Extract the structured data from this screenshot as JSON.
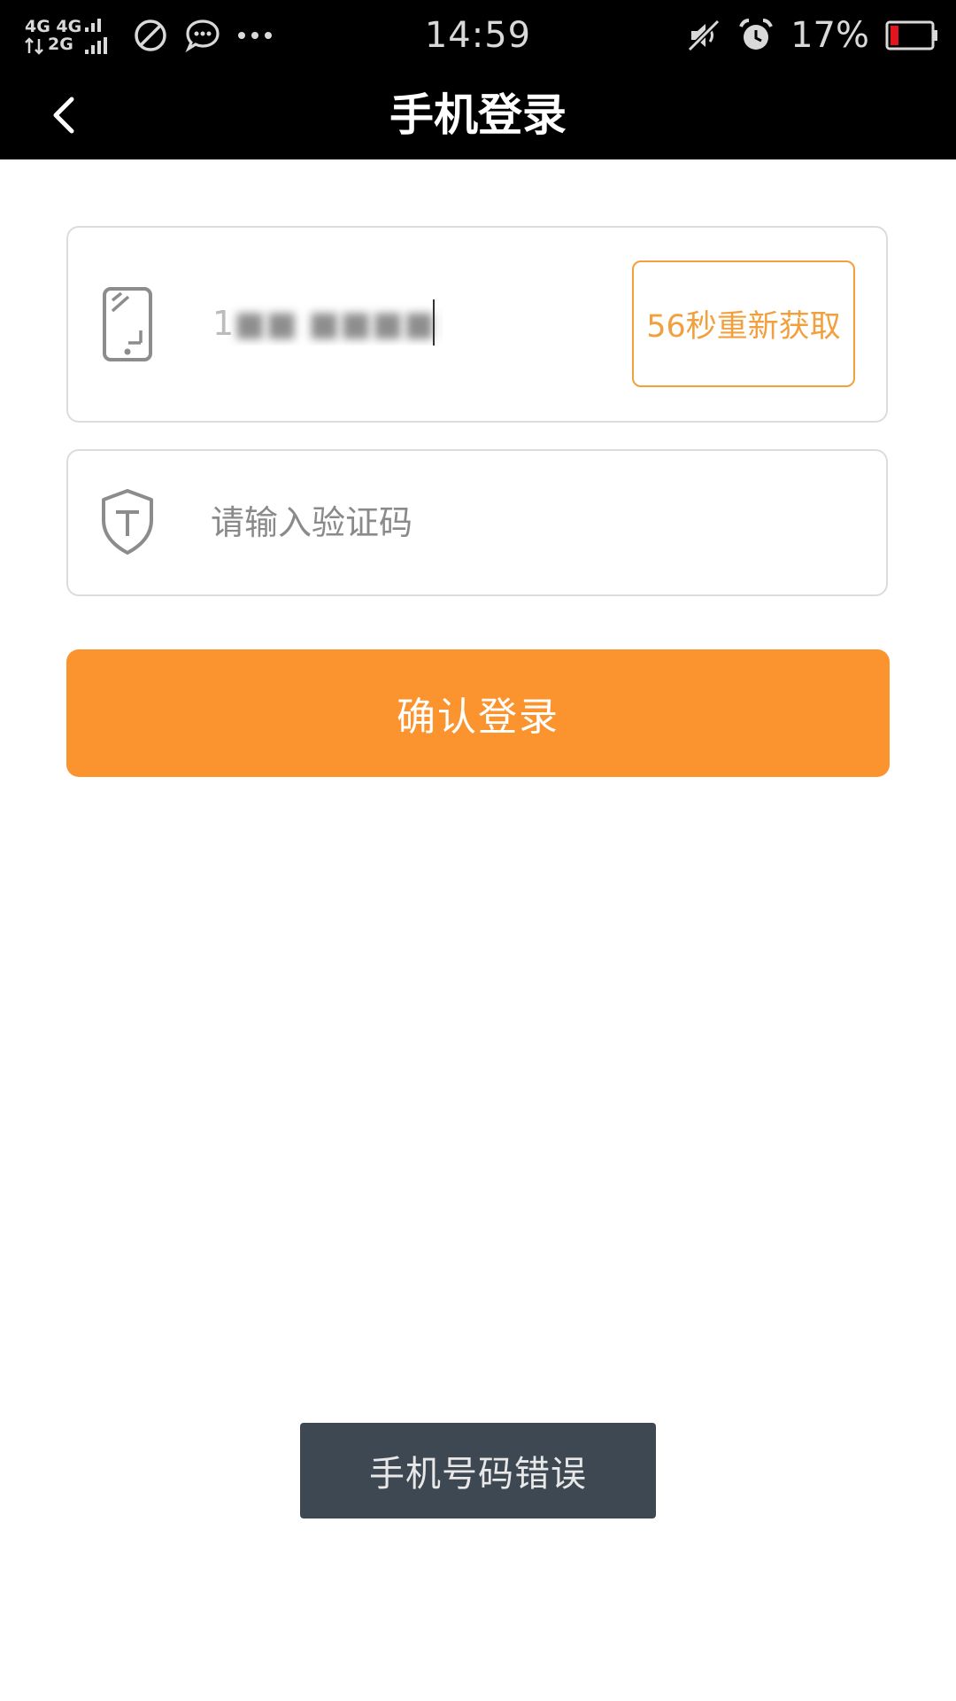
{
  "status_bar": {
    "network_line1": "4G 4G",
    "network_line2": "2G",
    "time": "14:59",
    "battery_percent": "17%",
    "icons": [
      "signal-icon",
      "do-not-disturb-icon",
      "message-icon",
      "more-icon",
      "mute-icon",
      "alarm-icon",
      "battery-icon"
    ]
  },
  "header": {
    "title": "手机登录",
    "back_icon": "chevron-left-icon"
  },
  "login_form": {
    "phone_icon": "phone-icon",
    "phone_value": "1",
    "resend_label": "56秒重新获取",
    "code_icon": "shield-icon",
    "code_placeholder": "请输入验证码",
    "confirm_label": "确认登录"
  },
  "toast": {
    "message": "手机号码错误"
  },
  "colors": {
    "accent": "#fb942e",
    "accent_border": "#f2a03d",
    "toast_bg": "#3e4852",
    "bar_bg": "#000000"
  }
}
